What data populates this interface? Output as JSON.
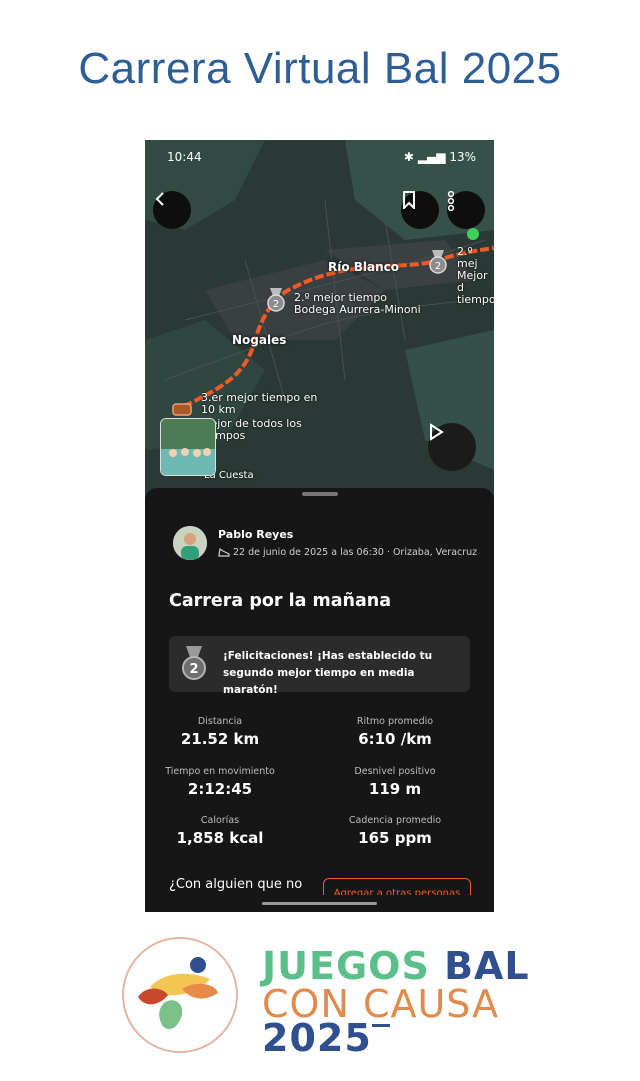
{
  "page": {
    "title": "Carrera Virtual Bal 2025"
  },
  "status_bar": {
    "time": "10:44",
    "battery": "13%"
  },
  "map": {
    "labels": {
      "segment1": [
        "2.º mejor tiempo",
        "Bodega Aurrera-Minoni"
      ],
      "segment2": [
        "2.º mej",
        "Mejor d",
        "tiempo"
      ],
      "segment3": [
        "3.er mejor tiempo en",
        "10 km",
        "Mejor de todos los",
        "tiempos"
      ]
    },
    "cities": {
      "rio_blanco": "Río Blanco",
      "nogales": "Nogales",
      "la_cuesta": "La Cuesta"
    },
    "route_color": "#f15a24"
  },
  "activity": {
    "user_name": "Pablo Reyes",
    "meta": "22 de junio de 2025 a las 06:30 · Orizaba, Veracruz",
    "title": "Carrera por la mañana",
    "achievement": [
      "¡Felicitaciones! ¡Has establecido tu",
      "segundo mejor tiempo en media maratón!"
    ],
    "achievement_badge": "2"
  },
  "stats": [
    {
      "label": "Distancia",
      "value": "21.52 km"
    },
    {
      "label": "Ritmo promedio",
      "value": "6:10 /km"
    },
    {
      "label": "Tiempo en movimiento",
      "value": "2:12:45"
    },
    {
      "label": "Desnivel positivo",
      "value": "119 m"
    },
    {
      "label": "Calorías",
      "value": "1,858 kcal"
    },
    {
      "label": "Cadencia promedio",
      "value": "165 ppm"
    }
  ],
  "footer_prompt": {
    "text": "¿Con alguien que no",
    "button": "Agregar a otras personas"
  },
  "brand": {
    "line1a": "JUEGOS",
    "line1b": "BAL",
    "line2": "CON CAUSA",
    "line3": "2025",
    "colors": {
      "green": "#5bbf8a",
      "blue": "#2f4f8f",
      "orange": "#e08a4c"
    }
  }
}
